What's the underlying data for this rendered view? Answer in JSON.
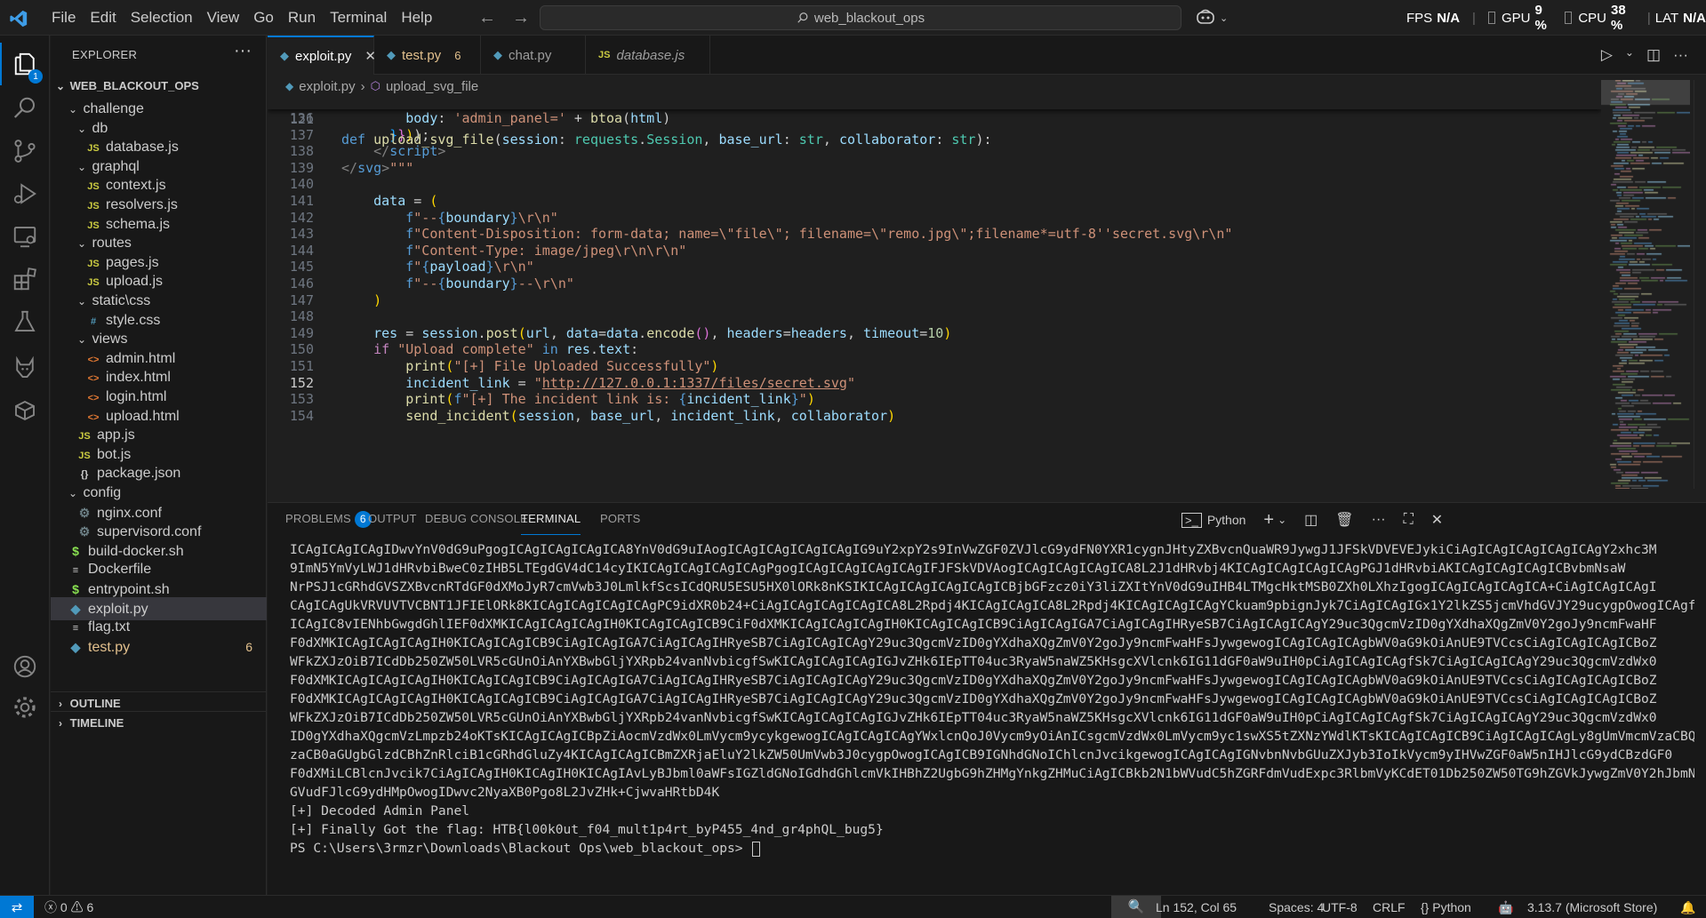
{
  "menus": [
    "File",
    "Edit",
    "Selection",
    "View",
    "Go",
    "Run",
    "Terminal",
    "Help"
  ],
  "search": {
    "text": "web_blackout_ops"
  },
  "perf": {
    "fps_label": "FPS",
    "fps_value": "N/A",
    "gpu_label": "GPU",
    "gpu_value": "9 %",
    "cpu_label": "CPU",
    "cpu_value": "38 %",
    "lat_label": "LAT",
    "lat_value": "N/A"
  },
  "activity": {
    "explorer_badge": "1"
  },
  "explorer": {
    "title": "EXPLORER",
    "root": "WEB_BLACKOUT_OPS",
    "items": [
      {
        "label": "challenge",
        "type": "folder",
        "depth": 1
      },
      {
        "label": "db",
        "type": "folder",
        "depth": 2
      },
      {
        "label": "database.js",
        "type": "js",
        "depth": 3
      },
      {
        "label": "graphql",
        "type": "folder",
        "depth": 2
      },
      {
        "label": "context.js",
        "type": "js",
        "depth": 3
      },
      {
        "label": "resolvers.js",
        "type": "js",
        "depth": 3
      },
      {
        "label": "schema.js",
        "type": "js",
        "depth": 3
      },
      {
        "label": "routes",
        "type": "folder",
        "depth": 2
      },
      {
        "label": "pages.js",
        "type": "js",
        "depth": 3
      },
      {
        "label": "upload.js",
        "type": "js",
        "depth": 3
      },
      {
        "label": "static\\css",
        "type": "folder",
        "depth": 2
      },
      {
        "label": "style.css",
        "type": "css",
        "depth": 3
      },
      {
        "label": "views",
        "type": "folder",
        "depth": 2
      },
      {
        "label": "admin.html",
        "type": "html",
        "depth": 3
      },
      {
        "label": "index.html",
        "type": "html",
        "depth": 3
      },
      {
        "label": "login.html",
        "type": "html",
        "depth": 3
      },
      {
        "label": "upload.html",
        "type": "html",
        "depth": 3
      },
      {
        "label": "app.js",
        "type": "js",
        "depth": 2
      },
      {
        "label": "bot.js",
        "type": "js",
        "depth": 2
      },
      {
        "label": "package.json",
        "type": "json",
        "depth": 2
      },
      {
        "label": "config",
        "type": "folder",
        "depth": 1
      },
      {
        "label": "nginx.conf",
        "type": "gear",
        "depth": 2
      },
      {
        "label": "supervisord.conf",
        "type": "gear",
        "depth": 2
      },
      {
        "label": "build-docker.sh",
        "type": "sh",
        "depth": 1
      },
      {
        "label": "Dockerfile",
        "type": "docker",
        "depth": 1
      },
      {
        "label": "entrypoint.sh",
        "type": "sh",
        "depth": 1
      },
      {
        "label": "exploit.py",
        "type": "py",
        "depth": 1,
        "selected": true
      },
      {
        "label": "flag.txt",
        "type": "txt",
        "depth": 1
      },
      {
        "label": "test.py",
        "type": "py",
        "depth": 1,
        "modified": true,
        "badge": "6"
      }
    ],
    "outline": "OUTLINE",
    "timeline": "TIMELINE"
  },
  "tabs": [
    {
      "label": "exploit.py",
      "icon": "py",
      "active": true
    },
    {
      "label": "test.py",
      "icon": "py",
      "badge": "6",
      "modified": true
    },
    {
      "label": "chat.py",
      "icon": "py"
    },
    {
      "label": "database.js",
      "icon": "js",
      "italic": true
    }
  ],
  "breadcrumb": {
    "file": "exploit.py",
    "symbol": "upload_svg_file"
  },
  "code": {
    "sticky_line_number": "121",
    "line_numbers": [
      "136",
      "137",
      "138",
      "139",
      "140",
      "141",
      "142",
      "143",
      "144",
      "145",
      "146",
      "147",
      "148",
      "149",
      "150",
      "151",
      "152",
      "153",
      "154"
    ],
    "current_line": "152"
  },
  "panel": {
    "tabs": [
      "PROBLEMS",
      "OUTPUT",
      "DEBUG CONSOLE",
      "TERMINAL",
      "PORTS"
    ],
    "problems_count": "6",
    "shell": "Python",
    "terminal_lines": [
      "ICAgICAgICAgIDwvYnV0dG9uPgogICAgICAgICAgICA8YnV0dG9uIAogICAgICAgICAgICAgIG9uY2xpY2s9InVwZGF0ZVJlcG9ydFN0YXR1cygnJHtyZXBvcnQuaWR9JywgJ1JFSkVDVEVEJykiCiAgICAgICAgICAgICAgY2xhc3M",
      "9ImN5YmVyLWJ1dHRvbiBweC0zIHB5LTEgdGV4dC14cyIKICAgICAgICAgICAgPgogICAgICAgICAgICAgIFJFSkVDVAogICAgICAgICAgICA8L2J1dHRvbj4KICAgICAgICAgICAgPGJ1dHRvbiAKICAgICAgICAgICBvbmNsaW",
      "NrPSJ1cGRhdGVSZXBvcnRTdGF0dXMoJyR7cmVwb3J0LmlkfScsICdQRU5ESU5HX0lORk8nKSIKICAgICAgICAgICAgICBjbGFzcz0iY3liZXItYnV0dG9uIHB4LTMgcHktMSB0ZXh0LXhzIgogICAgICAgICAgICA+CiAgICAgICAgI",
      "CAgICAgUkVRVUVTVCBNT1JFIElORk8KICAgICAgICAgICAgPC9idXR0b24+CiAgICAgICAgICAgICA8L2Rpdj4KICAgICAgICA8L2Rpdj4KICAgICAgICAgYCkuam9pbignJyk7CiAgICAgIGx1Y2lkZS5jcmVhdGVJY29ucygpOwogICAgfQoK",
      "ICAgIC8vIENhbGwgdGhlIEF0dXMKICAgICAgICAgIH0KICAgICAgICB9CiF0dXMKICAgICAgICAgIH0KICAgICAgICB9CiAgICAgIGA7CiAgICAgIHRyeSB7CiAgICAgICAgY29uc3QgcmVzID0gYXdhaXQgZmV0Y2goJy9ncmFwaHF",
      "F0dXMKICAgICAgICAgIH0KICAgICAgICB9CiAgICAgIGA7CiAgICAgIHRyeSB7CiAgICAgICAgY29uc3QgcmVzID0gYXdhaXQgZmV0Y2goJy9ncmFwaHFsJywgewogICAgICAgICAgbWV0aG9kOiAnUE9TVCcsCiAgICAgICAgICBoZ",
      "WFkZXJzOiB7ICdDb250ZW50LVR5cGUnOiAnYXBwbGljYXRpb24vanNvbicgfSwKICAgICAgICAgIGJvZHk6IEpTT04uc3RyaW5naWZ5KHsgcXVlcnk6IG11dGF0aW9uIH0pCiAgICAgICAgfSk7CiAgICAgICAgY29uc3QgcmVzdWx0",
      "F0dXMKICAgICAgICAgIH0KICAgICAgICB9CiAgICAgIGA7CiAgICAgIHRyeSB7CiAgICAgICAgY29uc3QgcmVzID0gYXdhaXQgZmV0Y2goJy9ncmFwaHFsJywgewogICAgICAgICAgbWV0aG9kOiAnUE9TVCcsCiAgICAgICAgICBoZ",
      "F0dXMKICAgICAgICAgIH0KICAgICAgICB9CiAgICAgIGA7CiAgICAgIHRyeSB7CiAgICAgICAgY29uc3QgcmVzID0gYXdhaXQgZmV0Y2goJy9ncmFwaHFsJywgewogICAgICAgICAgbWV0aG9kOiAnUE9TVCcsCiAgICAgICAgICBoZ",
      "WFkZXJzOiB7ICdDb250ZW50LVR5cGUnOiAnYXBwbGljYXRpb24vanNvbicgfSwKICAgICAgICAgIGJvZHk6IEpTT04uc3RyaW5naWZ5KHsgcXVlcnk6IG11dGF0aW9uIH0pCiAgICAgICAgfSk7CiAgICAgICAgY29uc3QgcmVzdWx0",
      "ID0gYXdhaXQgcmVzLmpzb24oKTsKICAgICAgICBpZiAocmVzdWx0LmVycm9ycykgewogICAgICAgICAgYWxlcnQoJ0Vycm9yOiAnICsgcmVzdWx0LmVycm9yc1swXS5tZXNzYWdlKTsKICAgICAgICB9CiAgICAgICAgLy8gUmVmcmVzaCBQ",
      "zaCB0aGUgbGlzdCBhZnRlciB1cGRhdGluZy4KICAgICAgICBmZXRjaEluY2lkZW50UmVwb3J0cygpOwogICAgICB9IGNhdGNoIChlcnJvcikgewogICAgICAgIGNvbnNvbGUuZXJyb3IoIkVycm9yIHVwZGF0aW5nIHJlcG9ydCBzdGF0",
      "F0dXMiLCBlcnJvcik7CiAgICAgIH0KICAgIH0KICAgIAvLyBJbml0aWFsIGZldGNoIGdhdGhlcmVkIHBhZ2UgbG9hZHMgYnkgZHMuCiAgICBkb2N1bWVudC5hZGRFdmVudExpc3RlbmVyKCdET01Db250ZW50TG9hZGVkJywgZmV0Y2hJbmNpZ",
      "GVudFJlcG9ydHMpOwogIDwvc2NyaXB0Pgo8L2JvZHk+CjwvaHRtbD4K",
      "[+] Decoded Admin Panel",
      "[+] Finally Got the flag: HTB{l00k0ut_f04_mult1p4rt_byP455_4nd_gr4phQL_bug5}",
      "PS C:\\Users\\3rmzr\\Downloads\\Blackout Ops\\web_blackout_ops> "
    ]
  },
  "status": {
    "errors": "0",
    "warnings": "6",
    "position": "Ln 152, Col 65",
    "spaces": "Spaces: 4",
    "encoding": "UTF-8",
    "eol": "CRLF",
    "language": "Python",
    "interpreter": "3.13.7 (Microsoft Store)"
  },
  "colors": {
    "accent": "#0078d4",
    "background": "#1f1f1f",
    "sidebar": "#181818"
  }
}
